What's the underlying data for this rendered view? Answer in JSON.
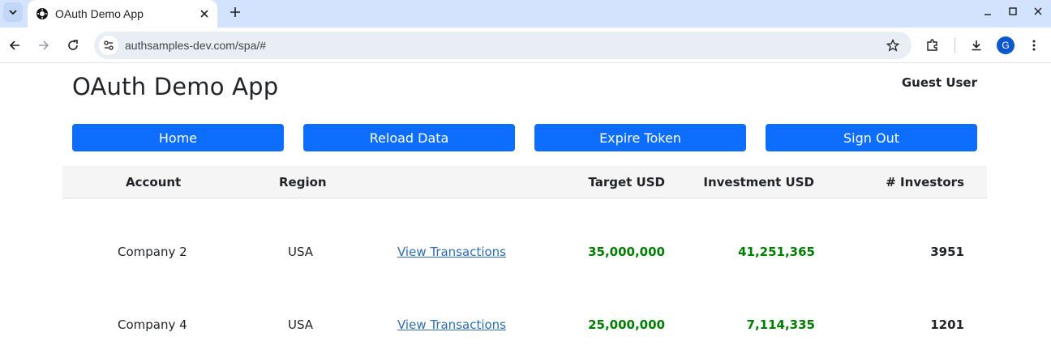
{
  "browser": {
    "tab_title": "OAuth Demo App",
    "url": "authsamples-dev.com/spa/#",
    "profile_initial": "G",
    "accent_color": "#0b57d0"
  },
  "app": {
    "title": "OAuth Demo App",
    "user_name": "Guest User",
    "buttons": {
      "home": "Home",
      "reload": "Reload Data",
      "expire": "Expire Token",
      "signout": "Sign Out"
    },
    "button_color": "#0d6efd",
    "table": {
      "headers": {
        "account": "Account",
        "region": "Region",
        "target": "Target USD",
        "investment": "Investment USD",
        "investors": "# Investors"
      },
      "rows": [
        {
          "account": "Company 2",
          "region": "USA",
          "link": "View Transactions",
          "target": "35,000,000",
          "investment": "41,251,365",
          "investors": "3951"
        },
        {
          "account": "Company 4",
          "region": "USA",
          "link": "View Transactions",
          "target": "25,000,000",
          "investment": "7,114,335",
          "investors": "1201"
        }
      ],
      "amount_color": "#008000"
    }
  }
}
